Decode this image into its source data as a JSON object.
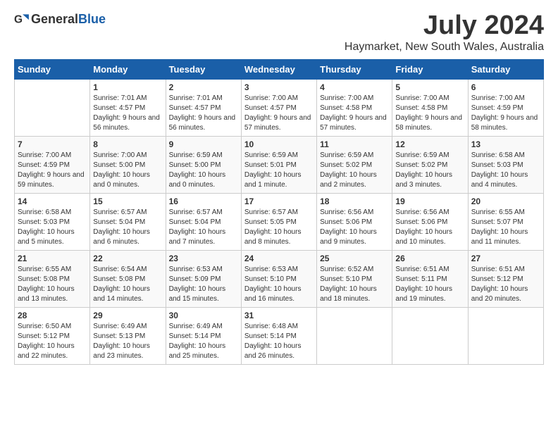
{
  "header": {
    "logo_general": "General",
    "logo_blue": "Blue",
    "month_title": "July 2024",
    "location": "Haymarket, New South Wales, Australia"
  },
  "weekdays": [
    "Sunday",
    "Monday",
    "Tuesday",
    "Wednesday",
    "Thursday",
    "Friday",
    "Saturday"
  ],
  "weeks": [
    [
      null,
      {
        "day": 1,
        "sunrise": "7:01 AM",
        "sunset": "4:57 PM",
        "daylight": "9 hours and 56 minutes."
      },
      {
        "day": 2,
        "sunrise": "7:01 AM",
        "sunset": "4:57 PM",
        "daylight": "9 hours and 56 minutes."
      },
      {
        "day": 3,
        "sunrise": "7:00 AM",
        "sunset": "4:57 PM",
        "daylight": "9 hours and 57 minutes."
      },
      {
        "day": 4,
        "sunrise": "7:00 AM",
        "sunset": "4:58 PM",
        "daylight": "9 hours and 57 minutes."
      },
      {
        "day": 5,
        "sunrise": "7:00 AM",
        "sunset": "4:58 PM",
        "daylight": "9 hours and 58 minutes."
      },
      {
        "day": 6,
        "sunrise": "7:00 AM",
        "sunset": "4:59 PM",
        "daylight": "9 hours and 58 minutes."
      }
    ],
    [
      {
        "day": 7,
        "sunrise": "7:00 AM",
        "sunset": "4:59 PM",
        "daylight": "9 hours and 59 minutes."
      },
      {
        "day": 8,
        "sunrise": "7:00 AM",
        "sunset": "5:00 PM",
        "daylight": "10 hours and 0 minutes."
      },
      {
        "day": 9,
        "sunrise": "6:59 AM",
        "sunset": "5:00 PM",
        "daylight": "10 hours and 0 minutes."
      },
      {
        "day": 10,
        "sunrise": "6:59 AM",
        "sunset": "5:01 PM",
        "daylight": "10 hours and 1 minute."
      },
      {
        "day": 11,
        "sunrise": "6:59 AM",
        "sunset": "5:02 PM",
        "daylight": "10 hours and 2 minutes."
      },
      {
        "day": 12,
        "sunrise": "6:59 AM",
        "sunset": "5:02 PM",
        "daylight": "10 hours and 3 minutes."
      },
      {
        "day": 13,
        "sunrise": "6:58 AM",
        "sunset": "5:03 PM",
        "daylight": "10 hours and 4 minutes."
      }
    ],
    [
      {
        "day": 14,
        "sunrise": "6:58 AM",
        "sunset": "5:03 PM",
        "daylight": "10 hours and 5 minutes."
      },
      {
        "day": 15,
        "sunrise": "6:57 AM",
        "sunset": "5:04 PM",
        "daylight": "10 hours and 6 minutes."
      },
      {
        "day": 16,
        "sunrise": "6:57 AM",
        "sunset": "5:04 PM",
        "daylight": "10 hours and 7 minutes."
      },
      {
        "day": 17,
        "sunrise": "6:57 AM",
        "sunset": "5:05 PM",
        "daylight": "10 hours and 8 minutes."
      },
      {
        "day": 18,
        "sunrise": "6:56 AM",
        "sunset": "5:06 PM",
        "daylight": "10 hours and 9 minutes."
      },
      {
        "day": 19,
        "sunrise": "6:56 AM",
        "sunset": "5:06 PM",
        "daylight": "10 hours and 10 minutes."
      },
      {
        "day": 20,
        "sunrise": "6:55 AM",
        "sunset": "5:07 PM",
        "daylight": "10 hours and 11 minutes."
      }
    ],
    [
      {
        "day": 21,
        "sunrise": "6:55 AM",
        "sunset": "5:08 PM",
        "daylight": "10 hours and 13 minutes."
      },
      {
        "day": 22,
        "sunrise": "6:54 AM",
        "sunset": "5:08 PM",
        "daylight": "10 hours and 14 minutes."
      },
      {
        "day": 23,
        "sunrise": "6:53 AM",
        "sunset": "5:09 PM",
        "daylight": "10 hours and 15 minutes."
      },
      {
        "day": 24,
        "sunrise": "6:53 AM",
        "sunset": "5:10 PM",
        "daylight": "10 hours and 16 minutes."
      },
      {
        "day": 25,
        "sunrise": "6:52 AM",
        "sunset": "5:10 PM",
        "daylight": "10 hours and 18 minutes."
      },
      {
        "day": 26,
        "sunrise": "6:51 AM",
        "sunset": "5:11 PM",
        "daylight": "10 hours and 19 minutes."
      },
      {
        "day": 27,
        "sunrise": "6:51 AM",
        "sunset": "5:12 PM",
        "daylight": "10 hours and 20 minutes."
      }
    ],
    [
      {
        "day": 28,
        "sunrise": "6:50 AM",
        "sunset": "5:12 PM",
        "daylight": "10 hours and 22 minutes."
      },
      {
        "day": 29,
        "sunrise": "6:49 AM",
        "sunset": "5:13 PM",
        "daylight": "10 hours and 23 minutes."
      },
      {
        "day": 30,
        "sunrise": "6:49 AM",
        "sunset": "5:14 PM",
        "daylight": "10 hours and 25 minutes."
      },
      {
        "day": 31,
        "sunrise": "6:48 AM",
        "sunset": "5:14 PM",
        "daylight": "10 hours and 26 minutes."
      },
      null,
      null,
      null
    ]
  ]
}
